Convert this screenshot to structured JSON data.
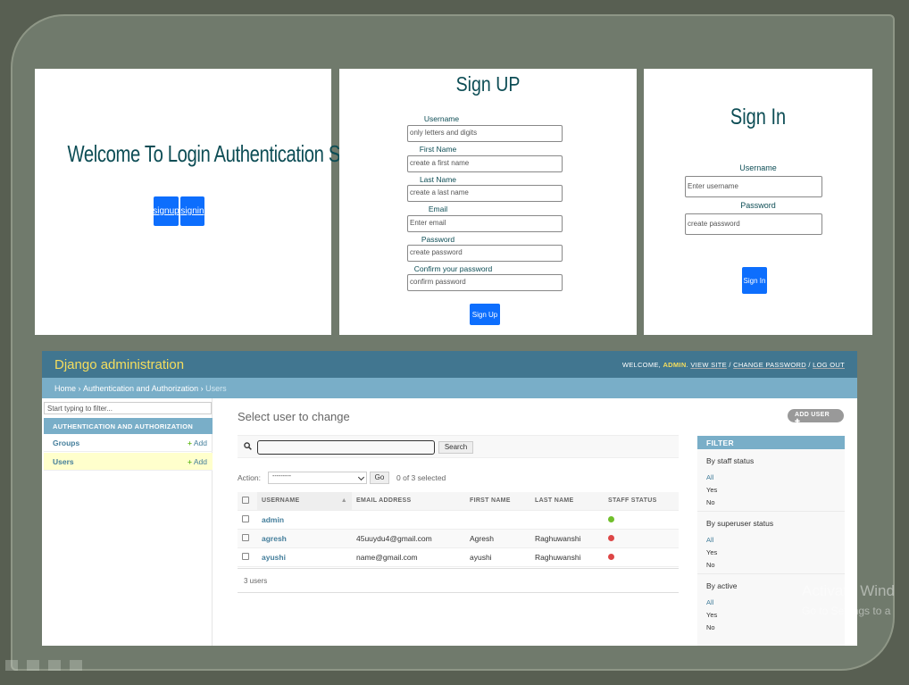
{
  "panel1": {
    "welcome": "Welcome To Login Authentication System",
    "signup_btn": "signup",
    "signin_btn": "signin"
  },
  "signup": {
    "title": "Sign UP",
    "fields": [
      {
        "label": "Username",
        "placeholder": "only letters and digits"
      },
      {
        "label": "First Name",
        "placeholder": "create a first name"
      },
      {
        "label": "Last Name",
        "placeholder": "create a last name"
      },
      {
        "label": "Email",
        "placeholder": "Enter email"
      },
      {
        "label": "Password",
        "placeholder": "create password"
      },
      {
        "label": "Confirm your password",
        "placeholder": "confirm password"
      }
    ],
    "button": "Sign Up"
  },
  "signin": {
    "title": "Sign In",
    "username_label": "Username",
    "username_placeholder": "Enter username",
    "password_label": "Password",
    "password_placeholder": "create password",
    "button": "Sign In"
  },
  "admin": {
    "brand": "Django administration",
    "welcome": "WELCOME,",
    "user": "ADMIN",
    "view_site": "VIEW SITE",
    "change_password": "CHANGE PASSWORD",
    "log_out": "LOG OUT",
    "crumbs": {
      "home": "Home",
      "app": "Authentication and Authorization",
      "current": "Users"
    },
    "nav_filter_placeholder": "Start typing to filter...",
    "app_caption": "AUTHENTICATION AND AUTHORIZATION",
    "models": [
      {
        "name": "Groups",
        "add": "Add"
      },
      {
        "name": "Users",
        "add": "Add"
      }
    ],
    "page_title": "Select user to change",
    "add_user": "ADD USER",
    "search_btn": "Search",
    "action_label": "Action:",
    "action_select": "---------",
    "go": "Go",
    "selected": "0 of 3 selected",
    "columns": [
      "USERNAME",
      "EMAIL ADDRESS",
      "FIRST NAME",
      "LAST NAME",
      "STAFF STATUS"
    ],
    "rows": [
      {
        "username": "admin",
        "email": "",
        "first": "",
        "last": "",
        "staff": true
      },
      {
        "username": "agresh",
        "email": "45uuydu4@gmail.com",
        "first": "Agresh",
        "last": "Raghuwanshi",
        "staff": false
      },
      {
        "username": "ayushi",
        "email": "name@gmail.com",
        "first": "ayushi",
        "last": "Raghuwanshi",
        "staff": false
      }
    ],
    "count": "3 users",
    "filter_title": "FILTER",
    "filters": [
      {
        "title": "By staff status",
        "options": [
          "All",
          "Yes",
          "No"
        ]
      },
      {
        "title": "By superuser status",
        "options": [
          "All",
          "Yes",
          "No"
        ]
      },
      {
        "title": "By active",
        "options": [
          "All",
          "Yes",
          "No"
        ]
      }
    ]
  },
  "watermark": {
    "line1": "Activate Wind",
    "line2": "Go to Settings to a"
  }
}
